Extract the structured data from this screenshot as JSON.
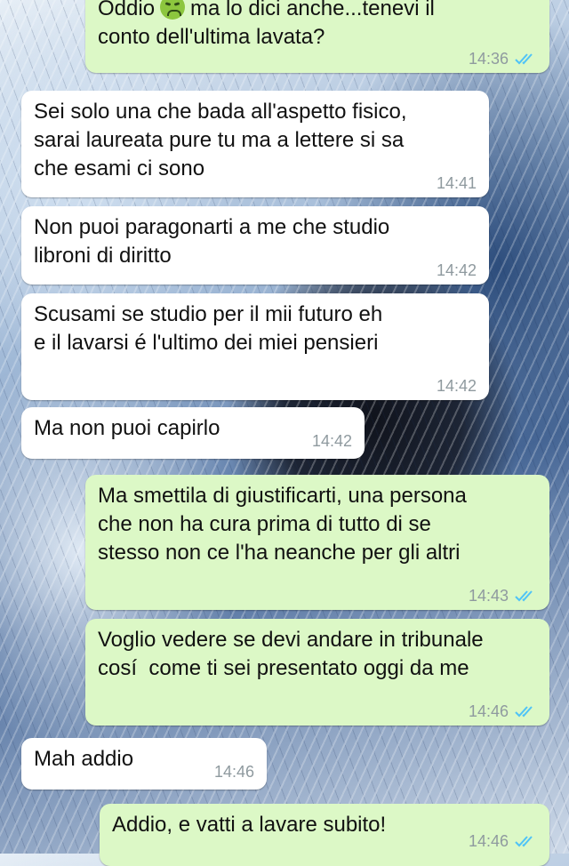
{
  "messages": [
    {
      "dir": "out",
      "text_before": "Oddio",
      "emoji": "nauseated-face",
      "text": "ma lo dici anche...tenevi il\nconto dell'ultima lavata?",
      "time": "14:36",
      "ticks": "double-blue"
    },
    {
      "dir": "in",
      "text": "Sei solo una che bada all'aspetto fisico,\nsarai laureata pure tu ma a lettere si sa\nche esami ci sono",
      "time": "14:41"
    },
    {
      "dir": "in",
      "text": "Non puoi paragonarti a me che studio\nlibroni di diritto",
      "time": "14:42"
    },
    {
      "dir": "in",
      "text": "Scusami se studio per il mii futuro eh\ne il lavarsi é l'ultimo dei miei pensieri",
      "time": "14:42"
    },
    {
      "dir": "in",
      "text": "Ma non puoi capirlo",
      "time": "14:42"
    },
    {
      "dir": "out",
      "text": "Ma smettila di giustificarti, una persona\nche non ha cura prima di tutto di se\nstesso non ce l'ha neanche per gli altri",
      "time": "14:43",
      "ticks": "double-blue"
    },
    {
      "dir": "out",
      "text": "Voglio vedere se devi andare in tribunale\ncosí  come ti sei presentato oggi da me",
      "time": "14:46",
      "ticks": "double-blue"
    },
    {
      "dir": "in",
      "text": "Mah addio",
      "time": "14:46"
    },
    {
      "dir": "out",
      "text": "Addio, e vatti a lavare subito!",
      "time": "14:46",
      "ticks": "double-blue"
    }
  ],
  "colors": {
    "outgoing_bubble": "#dcf8c6",
    "incoming_bubble": "#ffffff",
    "read_ticks": "#4fc3f7",
    "timestamp": "#8f9a9f"
  }
}
